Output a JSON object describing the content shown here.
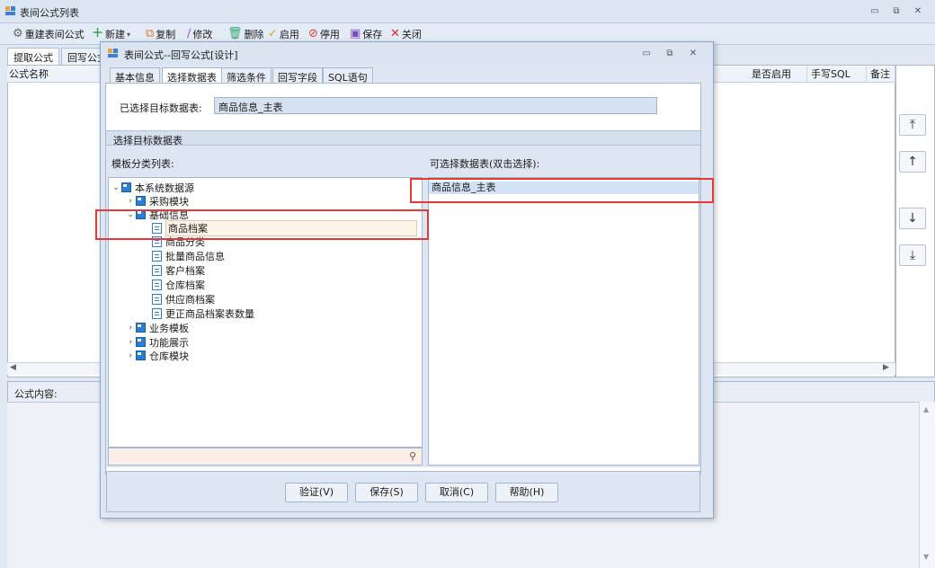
{
  "window": {
    "title": "表间公式列表"
  },
  "toolbar": {
    "items": [
      {
        "label": "重建表间公式",
        "icon": "gear-icon"
      },
      {
        "label": "新建",
        "icon": "plus-icon"
      },
      {
        "label": "复制",
        "icon": "copy-icon"
      },
      {
        "label": "修改",
        "icon": "pencil-icon"
      },
      {
        "label": "删除",
        "icon": "trash-icon"
      },
      {
        "label": "启用",
        "icon": "check-icon"
      },
      {
        "label": "停用",
        "icon": "stop-icon"
      },
      {
        "label": "保存",
        "icon": "save-icon"
      },
      {
        "label": "关闭",
        "icon": "close-icon"
      }
    ]
  },
  "main_tabs": [
    "提取公式",
    "回写公式"
  ],
  "grid": {
    "columns": [
      "公式名称",
      "是否启用",
      "手写SQL",
      "备注"
    ]
  },
  "content_label": "公式内容:",
  "dialog": {
    "title": "表间公式--回写公式[设计]",
    "tabs": [
      "基本信息",
      "选择数据表",
      "筛选条件",
      "回写字段",
      "SQL语句"
    ],
    "selected_label": "已选择目标数据表:",
    "selected_value": "商品信息_主表",
    "group_title": "选择目标数据表",
    "tree_label": "模板分类列表:",
    "list_label": "可选择数据表(双击选择):",
    "tree": {
      "root": "本系统数据源",
      "purchase": "采购模块",
      "basic": "基础信息",
      "children": [
        "商品档案",
        "商品分类",
        "批量商品信息",
        "客户档案",
        "仓库档案",
        "供应商档案",
        "更正商品档案表数量"
      ],
      "business": "业务模板",
      "demo": "功能展示",
      "warehouse": "仓库模块"
    },
    "list_items": [
      "商品信息_主表"
    ],
    "buttons": {
      "verify": "验证(V)",
      "save": "保存(S)",
      "cancel": "取消(C)",
      "help": "帮助(H)"
    }
  },
  "colors": {
    "highlight": "#e53935",
    "accent": "#2a7fd4"
  }
}
